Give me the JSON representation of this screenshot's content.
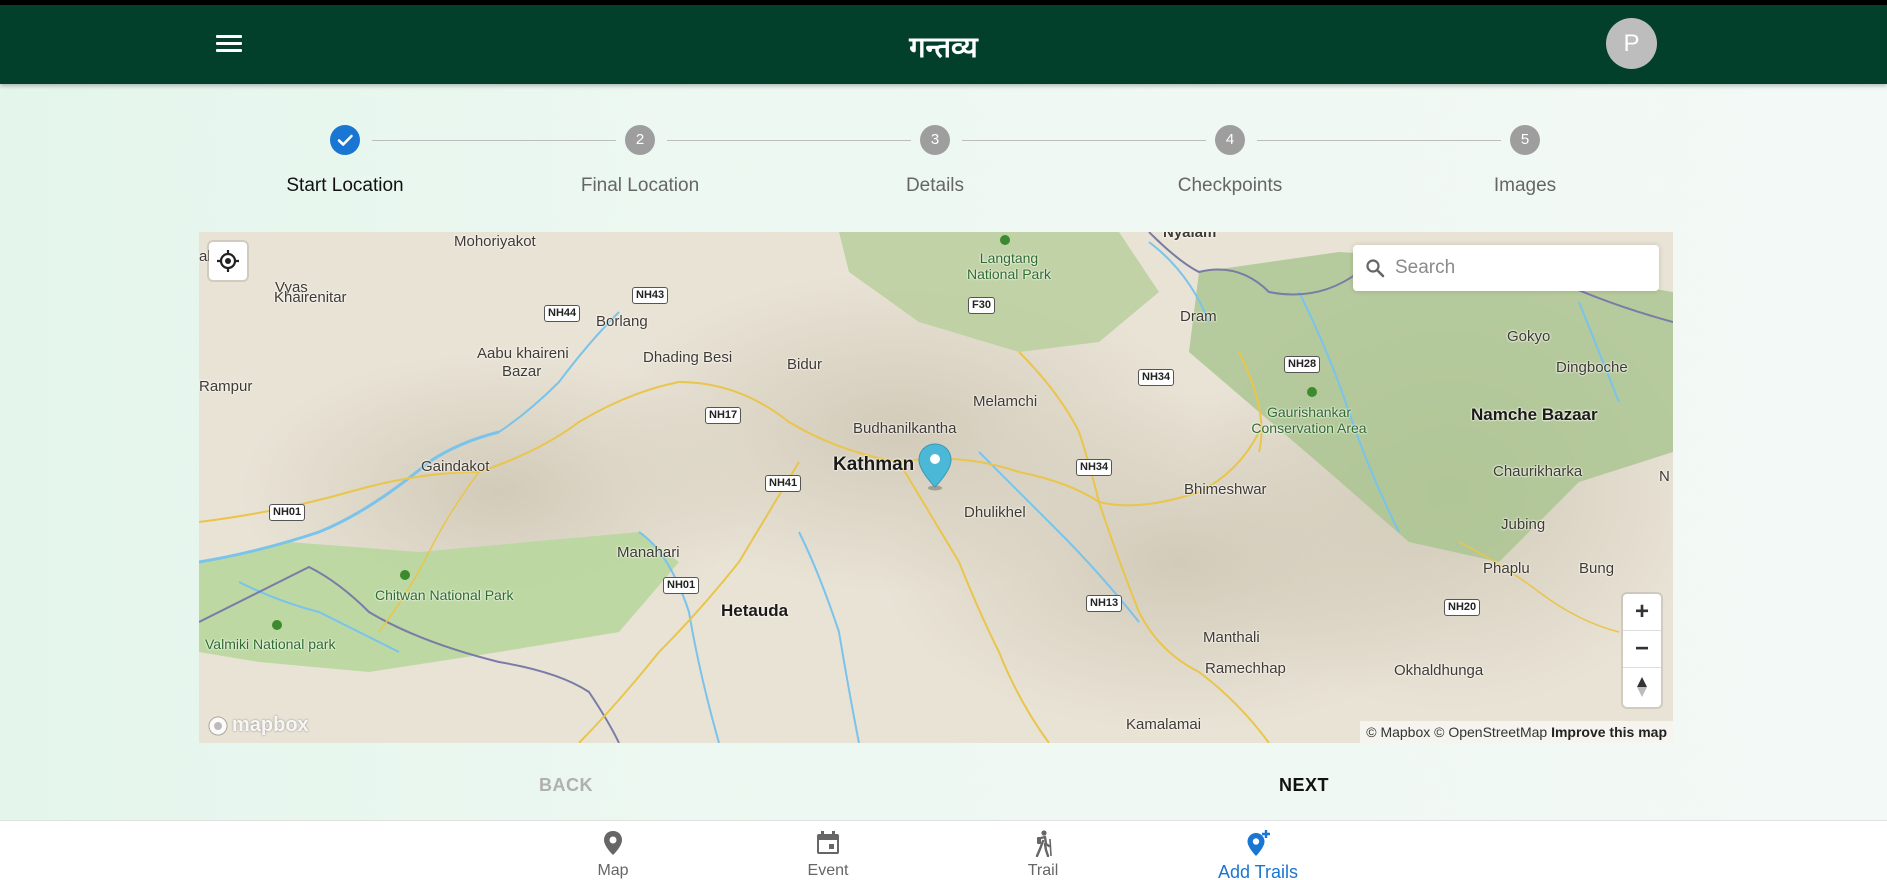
{
  "app": {
    "title": "गन्तव्य",
    "avatar_letter": "P"
  },
  "stepper": {
    "steps": [
      {
        "number": "1",
        "label": "Start Location",
        "state": "done"
      },
      {
        "number": "2",
        "label": "Final Location",
        "state": "pending"
      },
      {
        "number": "3",
        "label": "Details",
        "state": "pending"
      },
      {
        "number": "4",
        "label": "Checkpoints",
        "state": "pending"
      },
      {
        "number": "5",
        "label": "Images",
        "state": "pending"
      }
    ]
  },
  "map": {
    "search_placeholder": "Search",
    "attribution": "© Mapbox © OpenStreetMap",
    "improve_link": "Improve this map",
    "logo_text": "mapbox",
    "places": {
      "mohoriyakot": "Mohoriyakot",
      "khairenitar": "Khairenitar",
      "vyas": "Vyas",
      "aabu": "Aabu khaireni",
      "bazar": "Bazar",
      "borlang": "Borlang",
      "dhading": "Dhading Besi",
      "bidur": "Bidur",
      "rampur": "Rampur",
      "gaindakot": "Gaindakot",
      "kathmandu": "Kathman",
      "budhanilkantha": "Budhanilkantha",
      "melamchi": "Melamchi",
      "dhulikhel": "Dhulikhel",
      "manahari": "Manahari",
      "hetauda": "Hetauda",
      "chitwan": "Chitwan National Park",
      "valmiki": "Valmiki National park",
      "langtang": "Langtang National Park",
      "nyalam": "Nyalam",
      "dram": "Dram",
      "gaurishankar": "Gaurishankar Conservation Area",
      "gokyo": "Gokyo",
      "dingboche": "Dingboche",
      "namche": "Namche Bazaar",
      "chaurikharka": "Chaurikharka",
      "jubing": "Jubing",
      "phaplu": "Phaplu",
      "bung": "Bung",
      "bhimeshwar": "Bhimeshwar",
      "manthali": "Manthali",
      "ramechhap": "Ramechhap",
      "okhaldhunga": "Okhaldhunga",
      "kamalamai": "Kamalamai",
      "edge_ar": "al",
      "edge_n": "N"
    },
    "roads": {
      "nh43": "NH43",
      "nh44": "NH44",
      "nh17": "NH17",
      "nh41": "NH41",
      "nh01a": "NH01",
      "nh01b": "NH01",
      "nh13": "NH13",
      "nh34a": "NH34",
      "nh34b": "NH34",
      "nh28": "NH28",
      "nh20": "NH20",
      "f30": "F30"
    }
  },
  "actions": {
    "back": "BACK",
    "next": "NEXT"
  },
  "bottom_nav": {
    "items": [
      {
        "label": "Map",
        "icon": "map-pin-icon",
        "active": false
      },
      {
        "label": "Event",
        "icon": "calendar-icon",
        "active": false
      },
      {
        "label": "Trail",
        "icon": "hiker-icon",
        "active": false
      },
      {
        "label": "Add Trails",
        "icon": "add-location-icon",
        "active": true
      }
    ]
  },
  "colors": {
    "appbar": "#02402b",
    "accent": "#1976d2",
    "pin": "#4ab8d6"
  }
}
